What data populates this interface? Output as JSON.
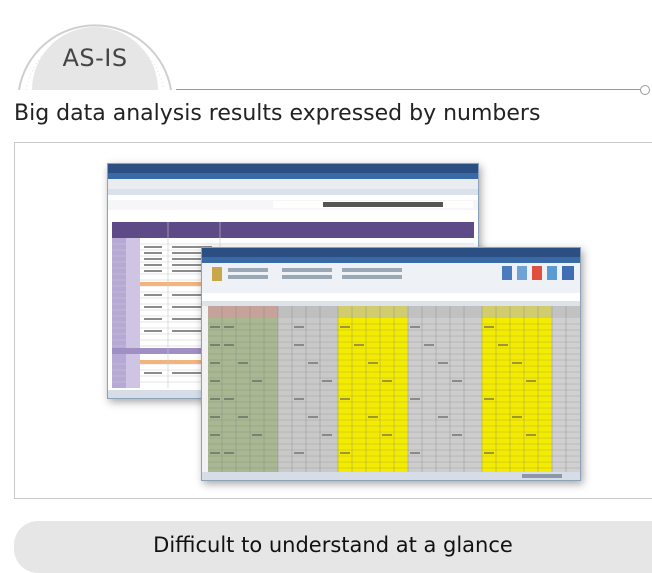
{
  "badge": {
    "label": "AS-IS"
  },
  "subtitle": "Big data analysis results expressed by numbers",
  "footer": {
    "label": "Difficult to understand at a glance"
  },
  "colors": {
    "accent_yellow": "#f4ec00",
    "sheet_green": "#a9b892",
    "header_purple": "#5d4a86",
    "window_blue": "#2b4f82",
    "pill_gray": "#e6e6e6"
  },
  "icons": [
    "spreadsheet-window-icon",
    "spreadsheet-window-icon"
  ]
}
